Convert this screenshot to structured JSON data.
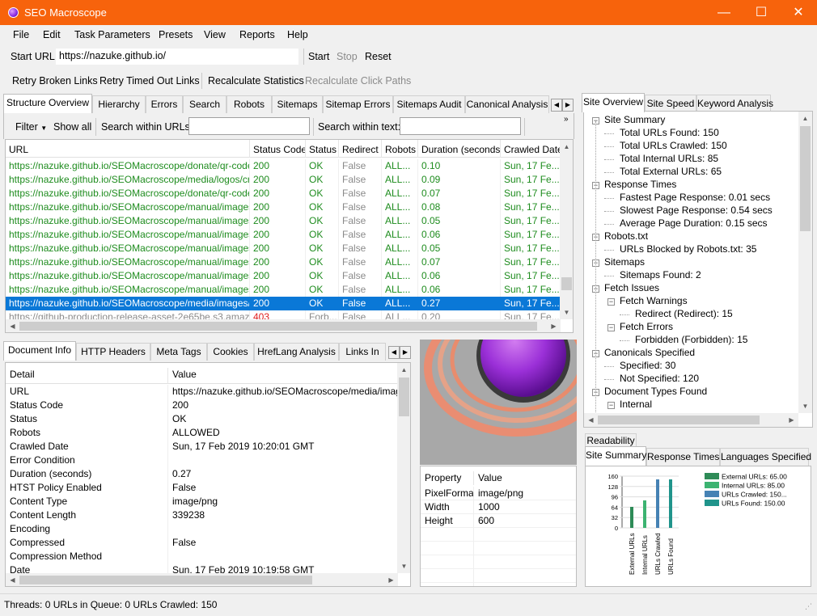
{
  "app": {
    "title": "SEO Macroscope"
  },
  "window_controls": {
    "minimize": "—",
    "maximize": "☐",
    "close": "✕"
  },
  "menu": [
    "File",
    "Edit",
    "Task Parameters",
    "Presets",
    "View",
    "Reports",
    "Help"
  ],
  "url_bar": {
    "label": "Start URL:",
    "value": "https://nazuke.github.io/",
    "start": "Start",
    "stop": "Stop",
    "reset": "Reset"
  },
  "toolbar2": {
    "retry_broken": "Retry Broken Links",
    "retry_timed_out": "Retry Timed Out Links",
    "recalc_stats": "Recalculate Statistics",
    "recalc_click": "Recalculate Click Paths"
  },
  "main_tabs": [
    "Structure Overview",
    "Hierarchy",
    "Errors",
    "Search",
    "Robots",
    "Sitemaps",
    "Sitemap Errors",
    "Sitemaps Audit",
    "Canonical Analysis"
  ],
  "filter_bar": {
    "filter": "Filter",
    "show_all": "Show all",
    "search_urls_label": "Search within URLs:",
    "search_text_label": "Search within text:",
    "search_urls_value": "",
    "search_text_value": ""
  },
  "grid": {
    "columns": [
      "URL",
      "Status Code",
      "Status",
      "Redirect",
      "Robots",
      "Duration (seconds)",
      "Crawled Date"
    ],
    "rows": [
      {
        "url": "https://nazuke.github.io/SEOMacroscope/donate/qr-code...",
        "code": "200",
        "status": "OK",
        "redirect": "False",
        "robots": "ALL...",
        "duration": "0.10",
        "date": "Sun, 17 Fe...",
        "style": "green"
      },
      {
        "url": "https://nazuke.github.io/SEOMacroscope/media/logos/cry...",
        "code": "200",
        "status": "OK",
        "redirect": "False",
        "robots": "ALL...",
        "duration": "0.09",
        "date": "Sun, 17 Fe...",
        "style": "green"
      },
      {
        "url": "https://nazuke.github.io/SEOMacroscope/donate/qr-code...",
        "code": "200",
        "status": "OK",
        "redirect": "False",
        "robots": "ALL...",
        "duration": "0.07",
        "date": "Sun, 17 Fe...",
        "style": "green"
      },
      {
        "url": "https://nazuke.github.io/SEOMacroscope/manual/images/...",
        "code": "200",
        "status": "OK",
        "redirect": "False",
        "robots": "ALL...",
        "duration": "0.08",
        "date": "Sun, 17 Fe...",
        "style": "green"
      },
      {
        "url": "https://nazuke.github.io/SEOMacroscope/manual/images/...",
        "code": "200",
        "status": "OK",
        "redirect": "False",
        "robots": "ALL...",
        "duration": "0.05",
        "date": "Sun, 17 Fe...",
        "style": "green"
      },
      {
        "url": "https://nazuke.github.io/SEOMacroscope/manual/images/...",
        "code": "200",
        "status": "OK",
        "redirect": "False",
        "robots": "ALL...",
        "duration": "0.06",
        "date": "Sun, 17 Fe...",
        "style": "green"
      },
      {
        "url": "https://nazuke.github.io/SEOMacroscope/manual/images/...",
        "code": "200",
        "status": "OK",
        "redirect": "False",
        "robots": "ALL...",
        "duration": "0.05",
        "date": "Sun, 17 Fe...",
        "style": "green"
      },
      {
        "url": "https://nazuke.github.io/SEOMacroscope/manual/images/...",
        "code": "200",
        "status": "OK",
        "redirect": "False",
        "robots": "ALL...",
        "duration": "0.07",
        "date": "Sun, 17 Fe...",
        "style": "green"
      },
      {
        "url": "https://nazuke.github.io/SEOMacroscope/manual/images/...",
        "code": "200",
        "status": "OK",
        "redirect": "False",
        "robots": "ALL...",
        "duration": "0.06",
        "date": "Sun, 17 Fe...",
        "style": "green"
      },
      {
        "url": "https://nazuke.github.io/SEOMacroscope/manual/images/...",
        "code": "200",
        "status": "OK",
        "redirect": "False",
        "robots": "ALL...",
        "duration": "0.06",
        "date": "Sun, 17 Fe...",
        "style": "green"
      },
      {
        "url": "https://nazuke.github.io/SEOMacroscope/media/images/j...",
        "code": "200",
        "status": "OK",
        "redirect": "False",
        "robots": "ALL...",
        "duration": "0.27",
        "date": "Sun, 17 Fe...",
        "style": "selected"
      },
      {
        "url": "https://github-production-release-asset-2e65be.s3.amazona...",
        "code": "403",
        "status": "Forb...",
        "redirect": "False",
        "robots": "ALL...",
        "duration": "0.20",
        "date": "Sun, 17 Fe...",
        "style": "gray"
      }
    ]
  },
  "bottom_tabs": [
    "Document Info",
    "HTTP Headers",
    "Meta Tags",
    "Cookies",
    "HrefLang Analysis",
    "Links In"
  ],
  "details": {
    "columns": [
      "Detail",
      "Value"
    ],
    "rows": [
      {
        "k": "URL",
        "v": "https://nazuke.github.io/SEOMacroscope/media/images/j"
      },
      {
        "k": "Status Code",
        "v": "200"
      },
      {
        "k": "Status",
        "v": "OK"
      },
      {
        "k": "Robots",
        "v": "ALLOWED"
      },
      {
        "k": "Crawled Date",
        "v": "Sun, 17 Feb 2019 10:20:01 GMT"
      },
      {
        "k": "Error Condition",
        "v": ""
      },
      {
        "k": "Duration (seconds)",
        "v": "0.27"
      },
      {
        "k": "HTST Policy Enabled",
        "v": "False"
      },
      {
        "k": "Content Type",
        "v": "image/png"
      },
      {
        "k": "Content Length",
        "v": "339238"
      },
      {
        "k": "Encoding",
        "v": ""
      },
      {
        "k": "Compressed",
        "v": "False"
      },
      {
        "k": "Compression Method",
        "v": ""
      },
      {
        "k": "Date",
        "v": "Sun, 17 Feb 2019 10:19:58 GMT"
      }
    ]
  },
  "image_props": {
    "columns": [
      "Property",
      "Value"
    ],
    "rows": [
      {
        "k": "PixelFormat",
        "v": "image/png"
      },
      {
        "k": "Width",
        "v": "1000"
      },
      {
        "k": "Height",
        "v": "600"
      }
    ]
  },
  "right_tabs": [
    "Site Overview",
    "Site Speed",
    "Keyword Analysis"
  ],
  "tree": [
    {
      "label": "Site Summary",
      "level": 0,
      "expander": true
    },
    {
      "label": "Total URLs Found: 150",
      "level": 1
    },
    {
      "label": "Total URLs Crawled: 150",
      "level": 1
    },
    {
      "label": "Total Internal URLs: 85",
      "level": 1
    },
    {
      "label": "Total External URLs: 65",
      "level": 1
    },
    {
      "label": "Response Times",
      "level": 0,
      "expander": true
    },
    {
      "label": "Fastest Page Response: 0.01 secs",
      "level": 1
    },
    {
      "label": "Slowest Page Response: 0.54 secs",
      "level": 1
    },
    {
      "label": "Average Page Duration: 0.15 secs",
      "level": 1
    },
    {
      "label": "Robots.txt",
      "level": 0,
      "expander": true
    },
    {
      "label": "URLs Blocked by Robots.txt: 35",
      "level": 1
    },
    {
      "label": "Sitemaps",
      "level": 0,
      "expander": true
    },
    {
      "label": "Sitemaps Found: 2",
      "level": 1
    },
    {
      "label": "Fetch Issues",
      "level": 0,
      "expander": true
    },
    {
      "label": "Fetch Warnings",
      "level": 1,
      "expander": true
    },
    {
      "label": "Redirect (Redirect): 15",
      "level": 2
    },
    {
      "label": "Fetch Errors",
      "level": 1,
      "expander": true
    },
    {
      "label": "Forbidden (Forbidden): 15",
      "level": 2
    },
    {
      "label": "Canonicals Specified",
      "level": 0,
      "expander": true
    },
    {
      "label": "Specified: 30",
      "level": 1
    },
    {
      "label": "Not Specified: 120",
      "level": 1
    },
    {
      "label": "Document Types Found",
      "level": 0,
      "expander": true
    },
    {
      "label": "Internal",
      "level": 1,
      "expander": true
    }
  ],
  "chart_tabs_top": [
    "Readability"
  ],
  "chart_tabs": [
    "Site Summary",
    "Response Times",
    "Languages Specified"
  ],
  "chart_data": {
    "type": "bar",
    "categories": [
      "External URLs",
      "Internal URLs",
      "URLs Crawled",
      "URLs Found"
    ],
    "values": [
      65,
      85,
      150,
      150
    ],
    "yticks": [
      "160",
      "128",
      "96",
      "64",
      "32",
      "0"
    ],
    "ylim": [
      0,
      160
    ],
    "legend": [
      "External URLs: 65.00",
      "Internal URLs: 85.00",
      "URLs Crawled: 150...",
      "URLs Found: 150.00"
    ],
    "colors": [
      "#2e8b57",
      "#3cb371",
      "#4682b4",
      "#20948b"
    ],
    "legend_position": "top-right"
  },
  "status_bar": "Threads: 0  URLs in Queue: 0  URLs Crawled: 150"
}
